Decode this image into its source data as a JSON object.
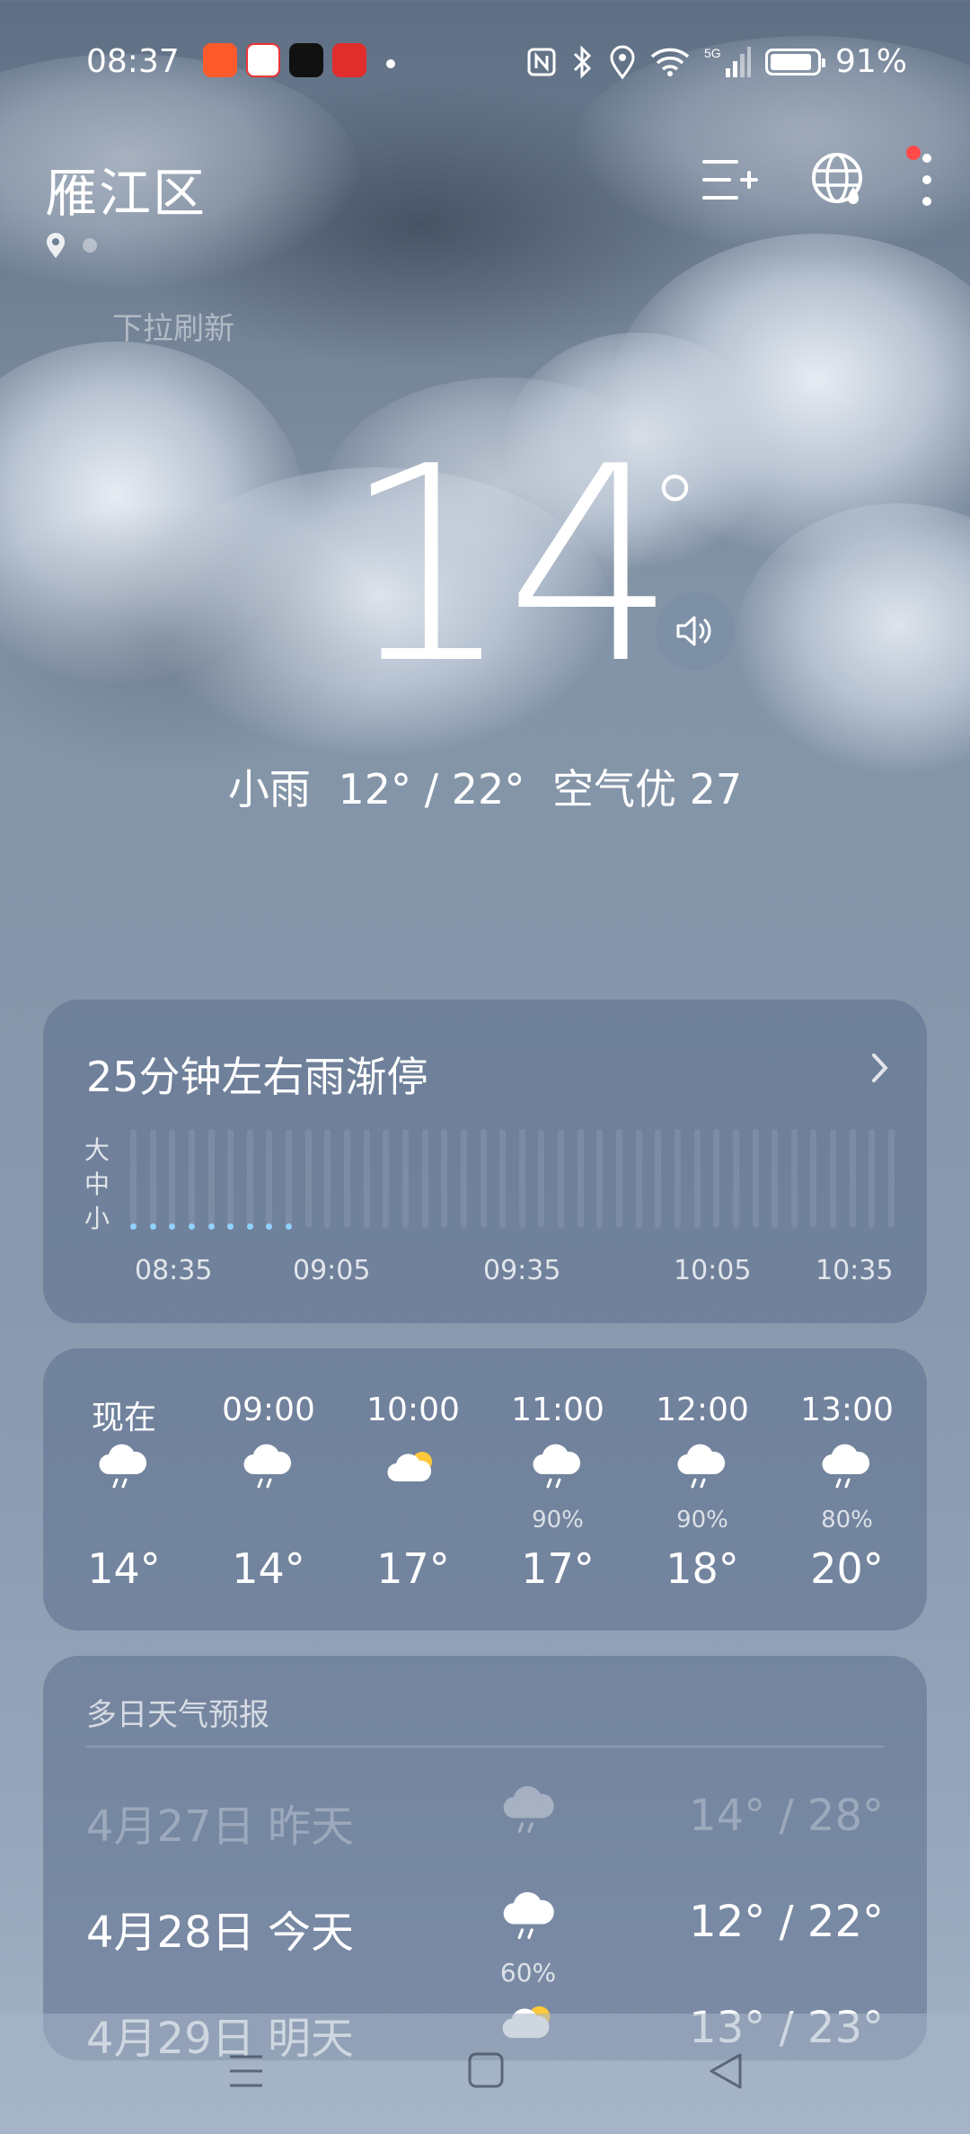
{
  "status_bar": {
    "time": "08:37",
    "app_icons": [
      {
        "name": "kuaishou-icon",
        "color": "#ff5a2c"
      },
      {
        "name": "toutiao-icon",
        "color": "#ffffff"
      },
      {
        "name": "douyin-icon",
        "color": "#111111"
      },
      {
        "name": "pinduoduo-icon",
        "color": "#e22d2d"
      }
    ],
    "network": "5G",
    "battery": "91%",
    "battery_level": 0.91
  },
  "header": {
    "city": "雁江区",
    "pull_hint": "下拉刷新"
  },
  "current": {
    "temperature": "14",
    "degree_symbol": "°",
    "condition": "小雨",
    "range": "12° / 22°",
    "air_quality": "空气优 27"
  },
  "precip_card": {
    "title": "25分钟左右雨渐停",
    "levels": [
      "大",
      "中",
      "小"
    ],
    "times": [
      "08:35",
      "09:05",
      "09:35",
      "10:05",
      "10:35"
    ],
    "rain_points": 9,
    "total_points": 40
  },
  "hourly": [
    {
      "hour": "现在",
      "icon": "rain-cloud-icon",
      "precip": "",
      "temp": "14°"
    },
    {
      "hour": "09:00",
      "icon": "rain-cloud-icon",
      "precip": "",
      "temp": "14°"
    },
    {
      "hour": "10:00",
      "icon": "cloud-sun-icon",
      "precip": "",
      "temp": "17°"
    },
    {
      "hour": "11:00",
      "icon": "rain-cloud-icon",
      "precip": "90%",
      "temp": "17°"
    },
    {
      "hour": "12:00",
      "icon": "rain-cloud-icon",
      "precip": "90%",
      "temp": "18°"
    },
    {
      "hour": "13:00",
      "icon": "rain-cloud-icon",
      "precip": "80%",
      "temp": "20°"
    }
  ],
  "forecast": {
    "title": "多日天气预报",
    "days": [
      {
        "date": "4月27日",
        "label": "昨天",
        "icon": "rain-cloud-icon",
        "precip": "",
        "range": "14° / 28°"
      },
      {
        "date": "4月28日",
        "label": "今天",
        "icon": "rain-cloud-icon",
        "precip": "60%",
        "range": "12° / 22°"
      },
      {
        "date": "4月29日",
        "label": "明天",
        "icon": "cloud-sun-icon",
        "precip": "",
        "range": "13° / 23°"
      }
    ]
  },
  "colors": {
    "accent_dot": "#8fd2ff",
    "notification_dot": "#ff4a4a"
  }
}
